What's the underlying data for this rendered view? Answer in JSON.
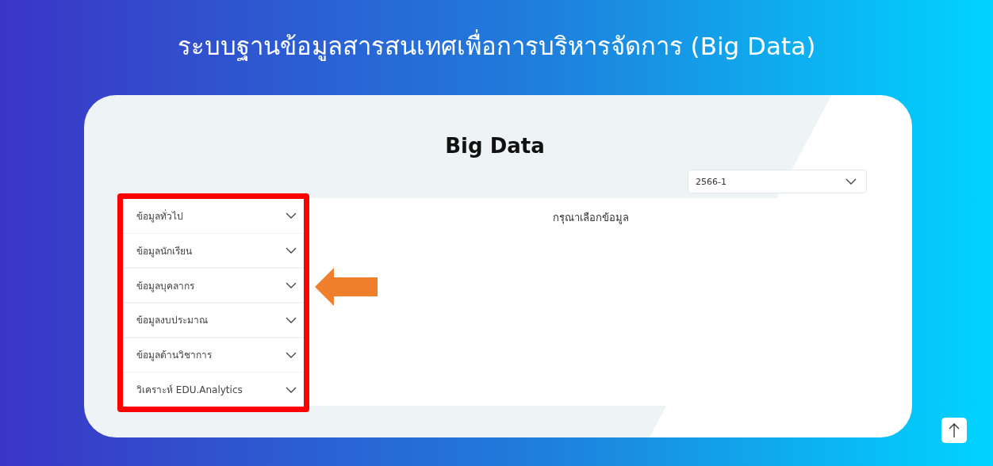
{
  "page_title": "ระบบฐานข้อมูลสารสนเทศเพื่อการบริหารจัดการ (Big Data)",
  "card": {
    "heading": "Big Data",
    "semester_select": {
      "value": "2566-1"
    },
    "sidebar": {
      "items": [
        {
          "label": "ข้อมูลทั่วไป",
          "expanded": false
        },
        {
          "label": "ข้อมูลนักเรียน",
          "expanded": false
        },
        {
          "label": "ข้อมูลบุคลากร",
          "expanded": false
        },
        {
          "label": "ข้อมูลงบประมาณ",
          "expanded": false
        },
        {
          "label": "ข้อมูลด้านวิชาการ",
          "expanded": false
        },
        {
          "label": "วิเคราะห์ EDU.Analytics",
          "expanded": false
        }
      ]
    },
    "content": {
      "message": "กรุณาเลือกข้อมูล"
    }
  }
}
